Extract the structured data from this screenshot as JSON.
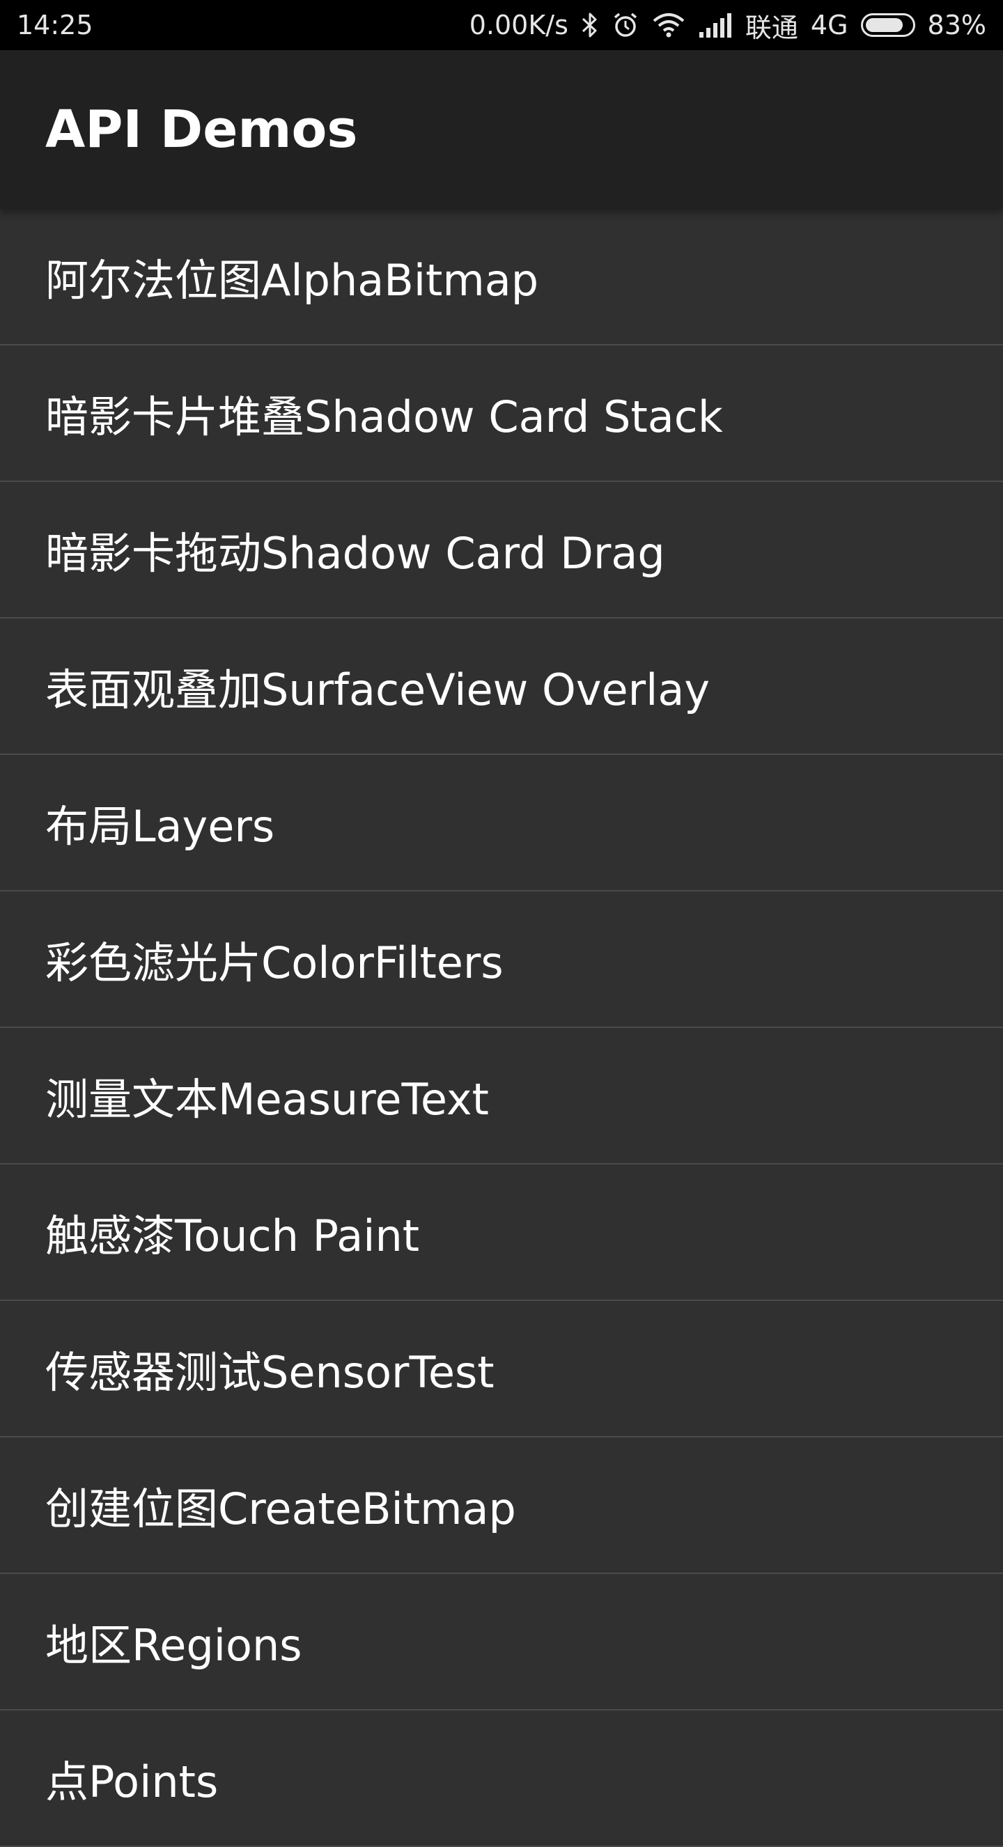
{
  "status_bar": {
    "time": "14:25",
    "net_speed": "0.00K/s",
    "carrier": "联通",
    "network_type": "4G",
    "battery_percent": "83%",
    "battery_level": 0.83,
    "icons": [
      "bluetooth-icon",
      "alarm-icon",
      "wifi-icon",
      "signal-icon",
      "battery-icon"
    ]
  },
  "app_bar": {
    "title": "API Demos"
  },
  "list": {
    "items": [
      {
        "label": "阿尔法位图AlphaBitmap"
      },
      {
        "label": "暗影卡片堆叠Shadow Card Stack"
      },
      {
        "label": "暗影卡拖动Shadow Card Drag"
      },
      {
        "label": "表面观叠加SurfaceView Overlay"
      },
      {
        "label": "布局Layers"
      },
      {
        "label": "彩色滤光片ColorFilters"
      },
      {
        "label": "测量文本MeasureText"
      },
      {
        "label": "触感漆Touch Paint"
      },
      {
        "label": "传感器测试SensorTest"
      },
      {
        "label": "创建位图CreateBitmap"
      },
      {
        "label": "地区Regions"
      },
      {
        "label": "点Points"
      }
    ]
  },
  "colors": {
    "status_bar_bg": "#000000",
    "app_bar_bg": "#212121",
    "list_bg": "#303030",
    "divider": "#4a4a4a",
    "text": "#ffffff"
  }
}
